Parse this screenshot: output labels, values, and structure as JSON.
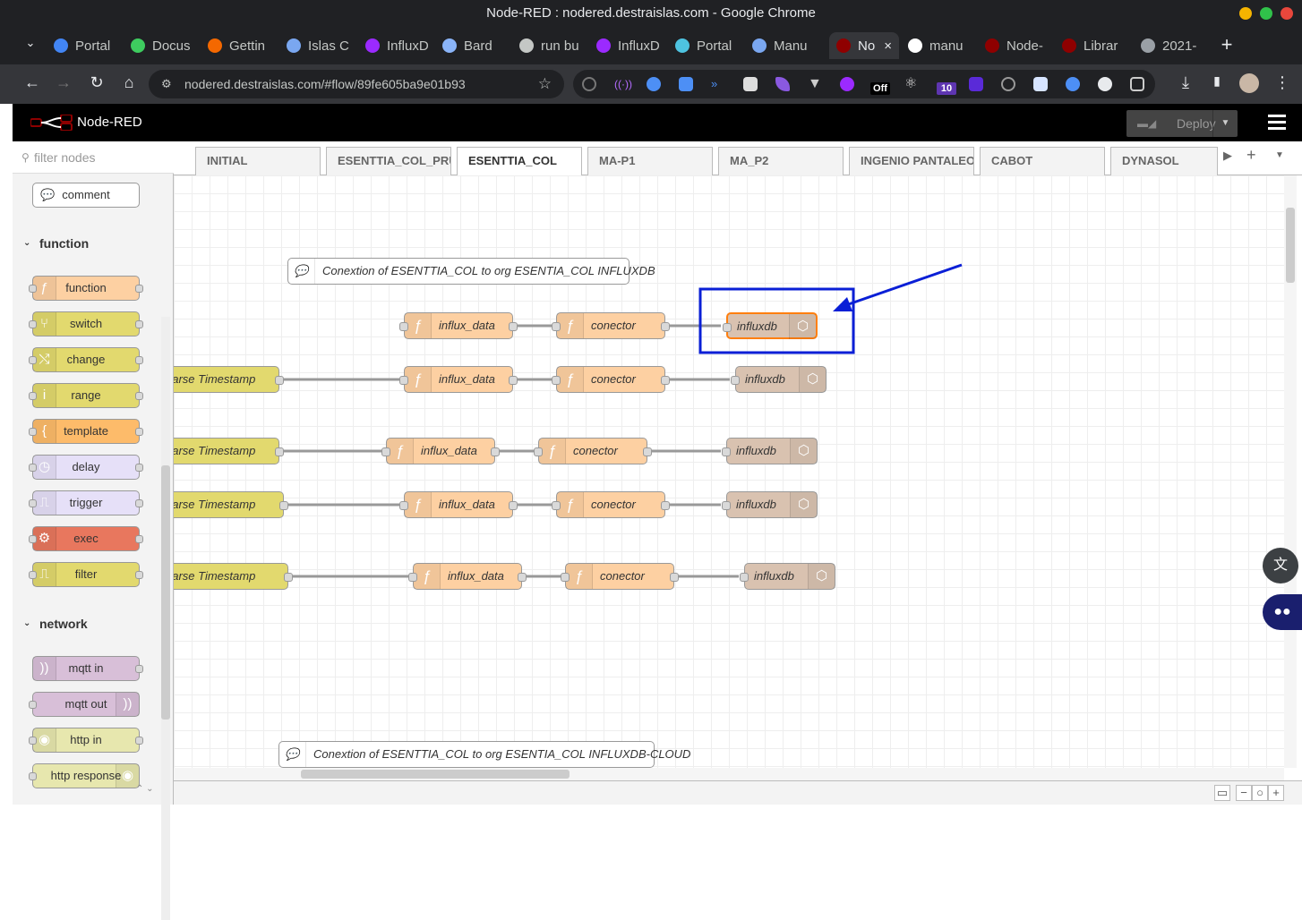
{
  "window": {
    "title": "Node-RED : nodered.destraislas.com - Google Chrome"
  },
  "browser_tabs": [
    {
      "label": "Portal",
      "icon": "globe-icon",
      "color": "#4285f4"
    },
    {
      "label": "Docus",
      "icon": "docusaurus-icon",
      "color": "#3ecc5f"
    },
    {
      "label": "Gettin",
      "icon": "getting-started-icon",
      "color": "#f46800"
    },
    {
      "label": "Islas C",
      "icon": "islas-icon",
      "color": "#7aa7f0"
    },
    {
      "label": "InfluxD",
      "icon": "influx-icon",
      "color": "#9b2aff"
    },
    {
      "label": "Bard",
      "icon": "bard-icon",
      "color": "#8ab4f8"
    },
    {
      "label": "run bu",
      "icon": "github-icon",
      "color": "#c4c7c5"
    },
    {
      "label": "InfluxD",
      "icon": "influx-icon",
      "color": "#9b2aff"
    },
    {
      "label": "Portal",
      "icon": "portainer-icon",
      "color": "#4ec3e0"
    },
    {
      "label": "Manu",
      "icon": "manual-icon",
      "color": "#7aa7f0"
    },
    {
      "label": "No",
      "icon": "nodered-icon",
      "color": "#8f0000"
    },
    {
      "label": "manu",
      "icon": "google-icon",
      "color": "#ffffff"
    },
    {
      "label": "Node-",
      "icon": "nodered-icon",
      "color": "#8f0000"
    },
    {
      "label": "Librar",
      "icon": "nodered-icon",
      "color": "#8f0000"
    },
    {
      "label": "2021-",
      "icon": "globe-icon",
      "color": "#9aa0a6"
    }
  ],
  "address_bar": {
    "url": "nodered.destraislas.com/#flow/89fe605ba9e01b93"
  },
  "extensions": {
    "badge_off": "Off",
    "badge_count": "10"
  },
  "nodered": {
    "brand": "Node-RED",
    "deploy_label": "Deploy",
    "palette": {
      "filter_placeholder": "filter nodes",
      "comment_label": "comment",
      "categories": [
        {
          "label": "function"
        },
        {
          "label": "network"
        }
      ],
      "function_nodes": [
        {
          "label": "function",
          "color": "#fdd0a2",
          "icon": "function-icon"
        },
        {
          "label": "switch",
          "color": "#e2d96e",
          "icon": "switch-icon"
        },
        {
          "label": "change",
          "color": "#e2d96e",
          "icon": "change-icon"
        },
        {
          "label": "range",
          "color": "#e2d96e",
          "icon": "range-icon"
        },
        {
          "label": "template",
          "color": "#fdbb6a",
          "icon": "template-icon"
        },
        {
          "label": "delay",
          "color": "#e6e0f8",
          "icon": "delay-icon"
        },
        {
          "label": "trigger",
          "color": "#e6e0f8",
          "icon": "trigger-icon"
        },
        {
          "label": "exec",
          "color": "#e8775e",
          "icon": "exec-icon"
        },
        {
          "label": "filter",
          "color": "#e2d96e",
          "icon": "filter-icon"
        }
      ],
      "network_nodes": [
        {
          "label": "mqtt in",
          "color": "#d8bfd8",
          "icon": "mqtt-icon"
        },
        {
          "label": "mqtt out",
          "color": "#d8bfd8",
          "icon": "mqtt-icon"
        },
        {
          "label": "http in",
          "color": "#e7e7ae",
          "icon": "globe-icon"
        },
        {
          "label": "http response",
          "color": "#e7e7ae",
          "icon": "globe-icon"
        }
      ]
    },
    "workspace_tabs": [
      "INITIAL",
      "ESENTTIA_COL_PRUEB",
      "ESENTTIA_COL",
      "MA-P1",
      "MA_P2",
      "INGENIO PANTALEON",
      "CABOT",
      "DYNASOL"
    ],
    "active_tab_index": 2,
    "flow": {
      "comment_top": "Conextion of ESENTTIA_COL to org ESENTIA_COL INFLUXDB",
      "comment_bottom": "Conextion of ESENTTIA_COL to org ESENTIA_COL INFLUXDB-CLOUD",
      "parse_label": "parse Timestamp",
      "influx_data_label": "influx_data",
      "conector_label": "conector",
      "influxdb_label": "influxdb",
      "highlight_color": "#0a1fd6",
      "node_colors": {
        "function": "#fdd0a2",
        "influxdb": "#d9c2b0",
        "parse": "#e2d96e"
      }
    }
  }
}
